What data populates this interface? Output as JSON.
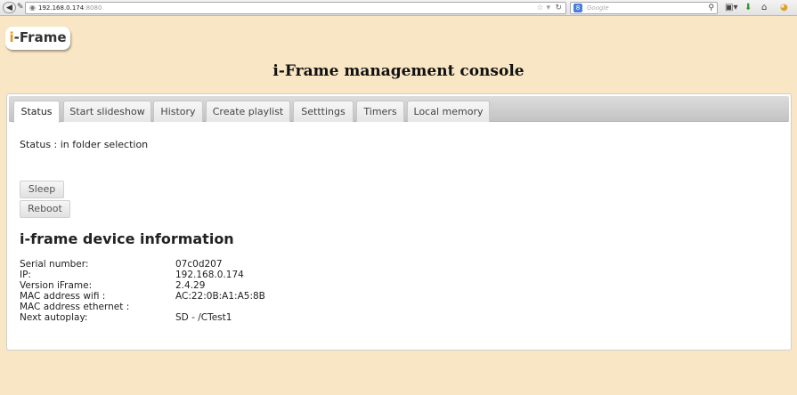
{
  "browser": {
    "url_host": "192.168.0.174",
    "url_port": ":8080",
    "search_placeholder": "Google",
    "icons": [
      "back-arrow-icon",
      "page-info-icon",
      "globe-icon",
      "bookmark-star-icon",
      "reload-icon",
      "search-engine-icon",
      "magnifier-icon",
      "bookmarks-menu-icon",
      "download-icon",
      "home-icon",
      "addon-icon"
    ]
  },
  "logo": {
    "prefix": "i",
    "rest": "-Frame"
  },
  "page": {
    "title": "i-Frame management console"
  },
  "tabs": [
    {
      "label": "Status",
      "active": true
    },
    {
      "label": "Start slideshow",
      "active": false
    },
    {
      "label": "History",
      "active": false
    },
    {
      "label": "Create playlist",
      "active": false
    },
    {
      "label": "Setttings",
      "active": false
    },
    {
      "label": "Timers",
      "active": false
    },
    {
      "label": "Local memory",
      "active": false
    }
  ],
  "status": {
    "text": "Status : in folder selection"
  },
  "buttons": {
    "sleep": "Sleep",
    "reboot": "Reboot"
  },
  "device_info": {
    "title": "i-frame device information",
    "rows": [
      {
        "key": "Serial number:",
        "value": "07c0d207"
      },
      {
        "key": "IP:",
        "value": "192.168.0.174"
      },
      {
        "key": "Version iFrame:",
        "value": "2.4.29"
      },
      {
        "key": "MAC address wifi :",
        "value": "AC:22:0B:A1:A5:8B"
      },
      {
        "key": "MAC address ethernet :",
        "value": ""
      },
      {
        "key": "Next autoplay:",
        "value": "SD - /CTest1"
      }
    ]
  },
  "colors": {
    "background": "#f8e6c4",
    "logo_accent": "#e39a1c"
  }
}
